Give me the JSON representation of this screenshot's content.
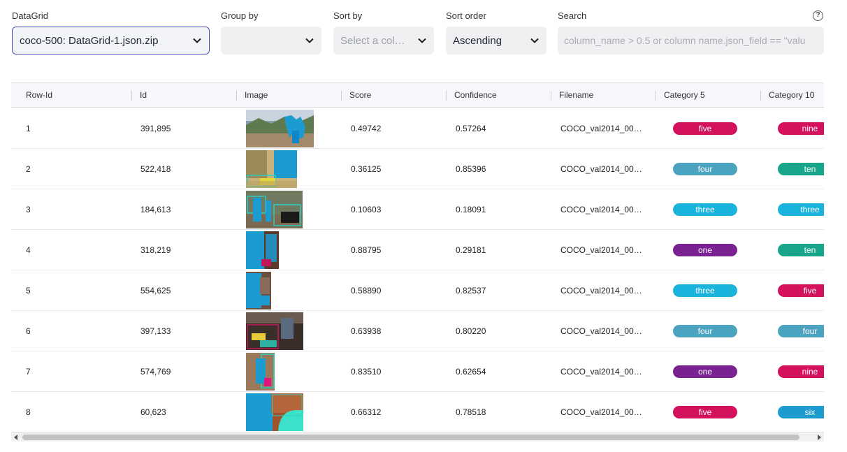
{
  "controls": {
    "datagrid": {
      "label": "DataGrid",
      "value": "coco-500: DataGrid-1.json.zip"
    },
    "group_by": {
      "label": "Group by",
      "value": ""
    },
    "sort_by": {
      "label": "Sort by",
      "placeholder": "Select a col…"
    },
    "sort_order": {
      "label": "Sort order",
      "value": "Ascending"
    },
    "search": {
      "label": "Search",
      "placeholder": "column_name > 0.5 or column name.json_field == \"valu"
    },
    "help_icon": "?"
  },
  "columns": [
    "Row-Id",
    "Id",
    "Image",
    "Score",
    "Confidence",
    "Filename",
    "Category 5",
    "Category 10"
  ],
  "rows": [
    {
      "row_id": "1",
      "id": "391,895",
      "score": "0.49742",
      "confidence": "0.57264",
      "filename": "COCO_val2014_00…",
      "cat5": "five",
      "cat10": "nine"
    },
    {
      "row_id": "2",
      "id": "522,418",
      "score": "0.36125",
      "confidence": "0.85396",
      "filename": "COCO_val2014_00…",
      "cat5": "four",
      "cat10": "ten"
    },
    {
      "row_id": "3",
      "id": "184,613",
      "score": "0.10603",
      "confidence": "0.18091",
      "filename": "COCO_val2014_00…",
      "cat5": "three",
      "cat10": "three"
    },
    {
      "row_id": "4",
      "id": "318,219",
      "score": "0.88795",
      "confidence": "0.29181",
      "filename": "COCO_val2014_00…",
      "cat5": "one",
      "cat10": "ten"
    },
    {
      "row_id": "5",
      "id": "554,625",
      "score": "0.58890",
      "confidence": "0.82537",
      "filename": "COCO_val2014_00…",
      "cat5": "three",
      "cat10": "five"
    },
    {
      "row_id": "6",
      "id": "397,133",
      "score": "0.63938",
      "confidence": "0.80220",
      "filename": "COCO_val2014_00…",
      "cat5": "four",
      "cat10": "four"
    },
    {
      "row_id": "7",
      "id": "574,769",
      "score": "0.83510",
      "confidence": "0.62654",
      "filename": "COCO_val2014_00…",
      "cat5": "one",
      "cat10": "nine"
    },
    {
      "row_id": "8",
      "id": "60,623",
      "score": "0.66312",
      "confidence": "0.78518",
      "filename": "COCO_val2014_00…",
      "cat5": "five",
      "cat10": "six"
    }
  ],
  "category_colors": {
    "one": "#7b2293",
    "three": "#19b3dc",
    "four": "#4ba3c0",
    "five": "#d3115c",
    "six": "#1d9bcf",
    "nine": "#d3115c",
    "ten": "#17a689"
  }
}
